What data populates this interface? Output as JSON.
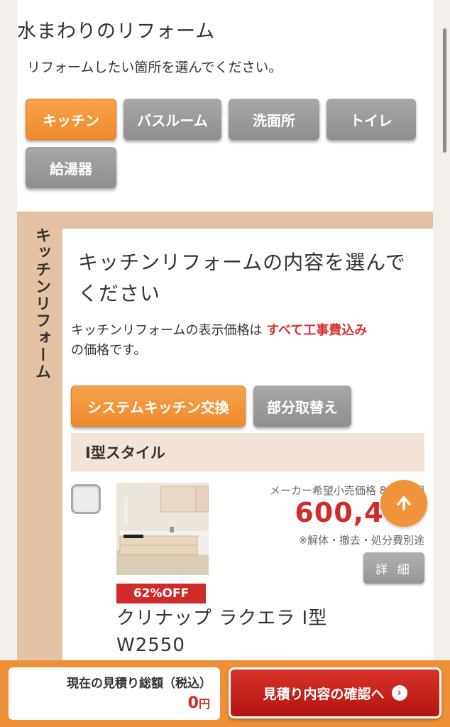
{
  "section": {
    "title": "水まわりのリフォーム",
    "description": "リフォームしたい箇所を選んでください。"
  },
  "categories": [
    {
      "label": "キッチン",
      "active": true
    },
    {
      "label": "バスルーム",
      "active": false
    },
    {
      "label": "洗面所",
      "active": false
    },
    {
      "label": "トイレ",
      "active": false
    },
    {
      "label": "給湯器",
      "active": false
    }
  ],
  "kitchen": {
    "side_label": "キッチンリフォーム",
    "title": "キッチンリフォームの内容を選んでください",
    "notice_prefix": "キッチンリフォームの表示価格は",
    "notice_highlight": "すべて工事費込み",
    "notice_suffix": "の価格です。",
    "options": [
      {
        "label": "システムキッチン交換",
        "active": true
      },
      {
        "label": "部分取替え",
        "active": false
      }
    ],
    "style_header": "I型スタイル"
  },
  "product": {
    "msrp_text": "メーカー希望小売価格 889,     円",
    "price": "600,40",
    "price_note": "※解体・撤去・処分費別途",
    "detail_label": "詳 細",
    "discount": "62%OFF",
    "name_line1": "クリナップ ラクエラ I型",
    "name_line2": "W2550",
    "checked": false
  },
  "footer": {
    "total_label": "現在の見積り総額（税込）",
    "total_value": "0",
    "total_unit": "円",
    "confirm_label": "見積り内容の確認へ"
  },
  "colors": {
    "accent_orange": "#ef8f38",
    "price_red": "#d02a2a",
    "band_beige": "#e4c2a4"
  },
  "icons": {
    "scroll_top": "arrow-up-icon",
    "confirm_arrow": "chevron-right-circle-icon"
  }
}
